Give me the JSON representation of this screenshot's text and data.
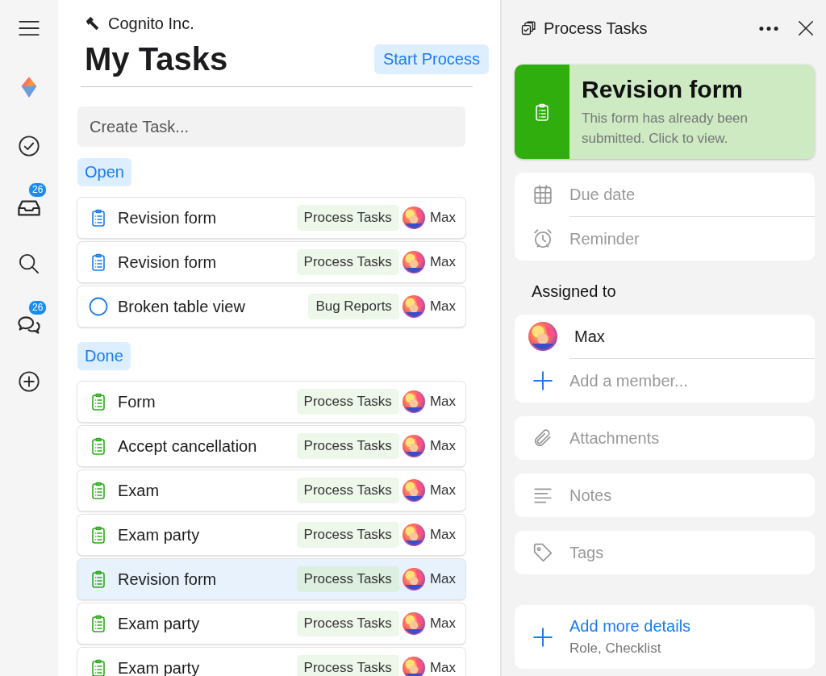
{
  "sidebar": {
    "items": [
      {
        "kind": "menu"
      },
      {
        "kind": "logo"
      },
      {
        "kind": "tasks"
      },
      {
        "kind": "inbox",
        "badge": "26"
      },
      {
        "kind": "search"
      },
      {
        "kind": "chat",
        "badge": "26"
      },
      {
        "kind": "add"
      }
    ]
  },
  "workspace": {
    "name": "Cognito Inc."
  },
  "page": {
    "title": "My Tasks",
    "action": "Start Process"
  },
  "create_task": {
    "placeholder": "Create Task..."
  },
  "groups": [
    {
      "label": "Open",
      "kind": "open",
      "tasks": [
        {
          "title": "Revision form",
          "kind": "form",
          "tag": "Process Tasks",
          "assignee": "Max",
          "selected": false
        },
        {
          "title": "Revision form",
          "kind": "form",
          "tag": "Process Tasks",
          "assignee": "Max",
          "selected": false
        },
        {
          "title": "Broken table view",
          "kind": "todo",
          "tag": "Bug Reports",
          "assignee": "Max",
          "selected": false
        }
      ]
    },
    {
      "label": "Done",
      "kind": "done",
      "tasks": [
        {
          "title": "Form",
          "kind": "form",
          "tag": "Process Tasks",
          "assignee": "Max",
          "selected": false
        },
        {
          "title": "Accept cancellation",
          "kind": "form",
          "tag": "Process Tasks",
          "assignee": "Max",
          "selected": false
        },
        {
          "title": "Exam",
          "kind": "form",
          "tag": "Process Tasks",
          "assignee": "Max",
          "selected": false
        },
        {
          "title": "Exam party",
          "kind": "form",
          "tag": "Process Tasks",
          "assignee": "Max",
          "selected": false
        },
        {
          "title": "Revision form",
          "kind": "form",
          "tag": "Process Tasks",
          "assignee": "Max",
          "selected": true
        },
        {
          "title": "Exam party",
          "kind": "form",
          "tag": "Process Tasks",
          "assignee": "Max",
          "selected": false
        },
        {
          "title": "Exam party",
          "kind": "form",
          "tag": "Process Tasks",
          "assignee": "Max",
          "selected": false
        }
      ]
    }
  ],
  "detail": {
    "title": "Process Tasks",
    "form_card": {
      "title": "Revision form",
      "description": "This form has already been submitted. Click to view."
    },
    "fields": [
      {
        "kind": "date",
        "label": "Due date"
      },
      {
        "kind": "reminder",
        "label": "Reminder"
      }
    ],
    "assigned_label": "Assigned to",
    "members": [
      {
        "name": "Max"
      }
    ],
    "add_member": {
      "placeholder": "Add a member..."
    },
    "sections": [
      {
        "kind": "attachment",
        "label": "Attachments"
      },
      {
        "kind": "notes",
        "label": "Notes"
      },
      {
        "kind": "tags",
        "label": "Tags"
      }
    ],
    "more": {
      "title": "Add more details",
      "subtitle": "Role, Checklist"
    }
  }
}
